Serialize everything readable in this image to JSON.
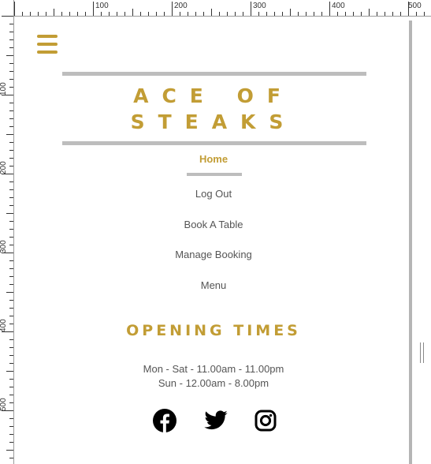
{
  "ruler": {
    "top_labels": [
      "100",
      "200",
      "300",
      "400",
      "500"
    ],
    "left_labels": [
      "100",
      "200",
      "300",
      "400",
      "500"
    ]
  },
  "menu_icon": "hamburger-icon",
  "brand": {
    "line1": "ACE OF",
    "line2": "STEAKS"
  },
  "nav": {
    "home": "Home",
    "logout": "Log Out",
    "book": "Book A Table",
    "manage": "Manage Booking",
    "menu": "Menu"
  },
  "opening": {
    "title": "OPENING TIMES",
    "weekday": "Mon - Sat - 11.00am - 11.00pm",
    "sunday": "Sun - 12.00am - 8.00pm"
  },
  "social": [
    "facebook-icon",
    "twitter-icon",
    "instagram-icon"
  ],
  "colors": {
    "accent": "#c29d35",
    "bar": "#bdbdbd",
    "text": "#555555"
  }
}
